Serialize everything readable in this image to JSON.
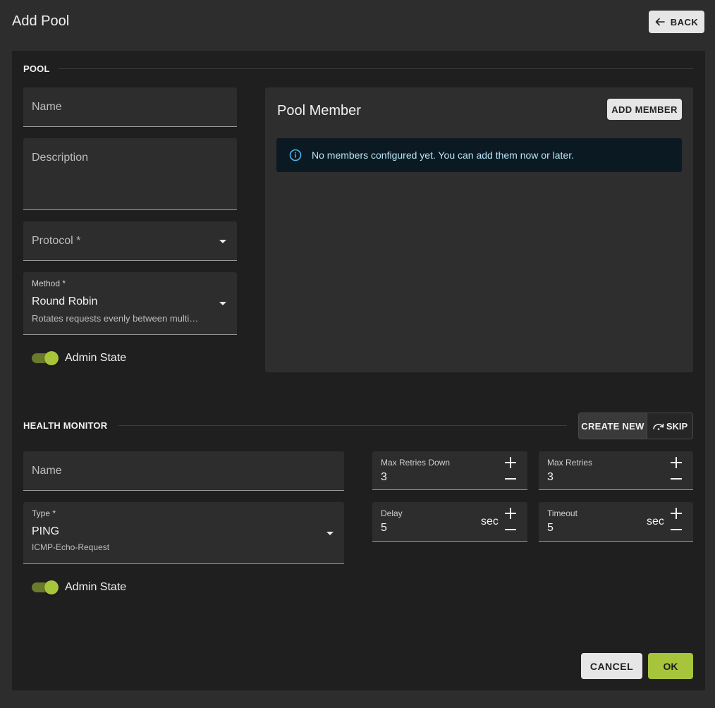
{
  "header": {
    "title": "Add Pool",
    "back_label": "BACK"
  },
  "pool": {
    "section_title": "POOL",
    "name_placeholder": "Name",
    "description_placeholder": "Description",
    "protocol_placeholder": "Protocol *",
    "method_label": "Method *",
    "method_value": "Round Robin",
    "method_description": "Rotates requests evenly between multi…",
    "admin_state_label": "Admin State",
    "admin_state_on": true
  },
  "pool_member": {
    "title": "Pool Member",
    "add_label": "ADD MEMBER",
    "info_message": "No members configured yet. You can add them now or later."
  },
  "health_monitor": {
    "section_title": "HEALTH MONITOR",
    "create_new_label": "CREATE NEW",
    "skip_label": "SKIP",
    "name_placeholder": "Name",
    "type_label": "Type *",
    "type_value": "PING",
    "type_description": "ICMP-Echo-Request",
    "max_retries_down_label": "Max Retries Down",
    "max_retries_down_value": "3",
    "max_retries_label": "Max Retries",
    "max_retries_value": "3",
    "delay_label": "Delay",
    "delay_value": "5",
    "delay_unit": "sec",
    "timeout_label": "Timeout",
    "timeout_value": "5",
    "timeout_unit": "sec",
    "admin_state_label": "Admin State",
    "admin_state_on": true
  },
  "footer": {
    "cancel_label": "CANCEL",
    "ok_label": "OK"
  },
  "colors": {
    "accent": "#a6c53a",
    "info_bg": "#0b1a22",
    "info_text": "#b9e3f7",
    "panel_bg": "#1f1f1f",
    "page_bg": "#2d2d2d"
  }
}
